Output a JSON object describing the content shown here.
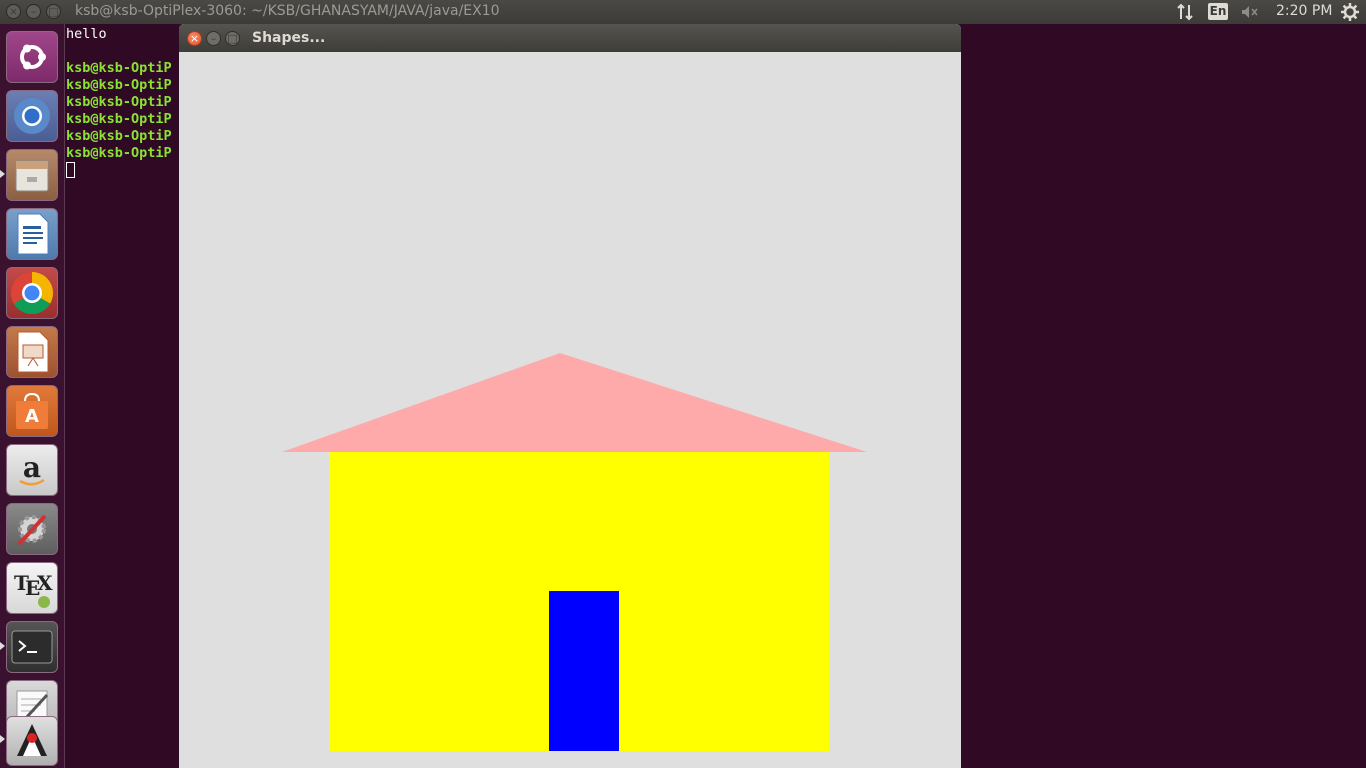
{
  "top_panel": {
    "window_title": "ksb@ksb-OptiPlex-3060: ~/KSB/GHANASYAM/JAVA/java/EX10",
    "network_icon": "network-updown-icon",
    "language": "En",
    "volume_icon": "volume-muted-icon",
    "clock": "2:20 PM",
    "settings_icon": "gear-icon"
  },
  "launcher": {
    "items": [
      {
        "name": "ubuntu-dash",
        "icon": "ubuntu-logo-icon"
      },
      {
        "name": "chromium",
        "icon": "chromium-icon"
      },
      {
        "name": "files",
        "icon": "file-cabinet-icon"
      },
      {
        "name": "libreoffice-writer",
        "icon": "document-icon"
      },
      {
        "name": "google-chrome",
        "icon": "chrome-icon"
      },
      {
        "name": "libreoffice-impress",
        "icon": "presentation-icon"
      },
      {
        "name": "ubuntu-software",
        "icon": "shopping-bag-icon"
      },
      {
        "name": "amazon",
        "icon": "amazon-icon"
      },
      {
        "name": "system-settings",
        "icon": "settings-wrench-icon"
      },
      {
        "name": "texworks",
        "icon": "tex-icon"
      },
      {
        "name": "terminal",
        "icon": "terminal-icon"
      },
      {
        "name": "text-editor",
        "icon": "text-editor-icon"
      },
      {
        "name": "java",
        "icon": "java-duke-icon"
      }
    ]
  },
  "terminal": {
    "lines": [
      "hello",
      "",
      "ksb@ksb-OptiP",
      "ksb@ksb-OptiP",
      "ksb@ksb-OptiP",
      "ksb@ksb-OptiP",
      "ksb@ksb-OptiP",
      "ksb@ksb-OptiP"
    ]
  },
  "shapes_window": {
    "title": "Shapes...",
    "background": "#dfdfdf",
    "roof_color": "#ffaaaa",
    "wall_color": "#ffff00",
    "door_color": "#0000ff"
  }
}
